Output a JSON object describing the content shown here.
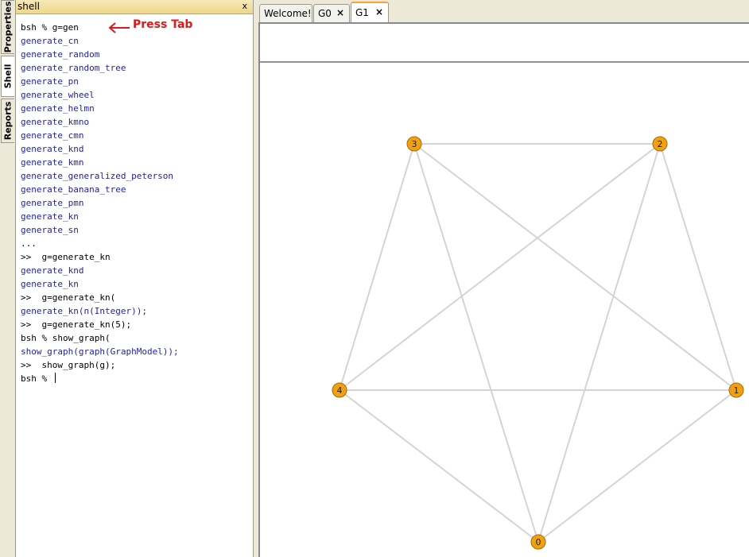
{
  "side_tabs": [
    "Properties",
    "Shell",
    "Reports"
  ],
  "shell": {
    "title": "shell",
    "close_label": "x",
    "lines": [
      {
        "text": "bsh % g=gen",
        "kind": "cmd"
      },
      {
        "text": "generate_cn",
        "kind": "out"
      },
      {
        "text": "generate_random",
        "kind": "out"
      },
      {
        "text": "generate_random_tree",
        "kind": "out"
      },
      {
        "text": "generate_pn",
        "kind": "out"
      },
      {
        "text": "generate_wheel",
        "kind": "out"
      },
      {
        "text": "generate_helmn",
        "kind": "out"
      },
      {
        "text": "generate_kmno",
        "kind": "out"
      },
      {
        "text": "generate_cmn",
        "kind": "out"
      },
      {
        "text": "generate_knd",
        "kind": "out"
      },
      {
        "text": "generate_kmn",
        "kind": "out"
      },
      {
        "text": "generate_generalized_peterson",
        "kind": "out"
      },
      {
        "text": "generate_banana_tree",
        "kind": "out"
      },
      {
        "text": "generate_pmn",
        "kind": "out"
      },
      {
        "text": "generate_kn",
        "kind": "out"
      },
      {
        "text": "generate_sn",
        "kind": "out"
      },
      {
        "text": "...",
        "kind": "cmd"
      },
      {
        "text": ">>  g=generate_kn",
        "kind": "cmd"
      },
      {
        "text": "generate_knd",
        "kind": "out"
      },
      {
        "text": "generate_kn",
        "kind": "out"
      },
      {
        "text": ">>  g=generate_kn(",
        "kind": "cmd"
      },
      {
        "text": "generate_kn(n(Integer));",
        "kind": "out"
      },
      {
        "text": ">>  g=generate_kn(5);",
        "kind": "cmd"
      },
      {
        "text": "bsh % show_graph(",
        "kind": "cmd"
      },
      {
        "text": "show_graph(graph(GraphModel));",
        "kind": "out"
      },
      {
        "text": ">>  show_graph(g);",
        "kind": "cmd"
      },
      {
        "text": "bsh % ",
        "kind": "cmd"
      }
    ]
  },
  "annotation": {
    "label": "Press Tab",
    "color": "#e01818"
  },
  "tabs": [
    {
      "label": "Welcome!",
      "closable": false,
      "active": false
    },
    {
      "label": "G0",
      "close_label": "×",
      "closable": true,
      "active": false
    },
    {
      "label": "G1",
      "close_label": "×",
      "closable": true,
      "active": true
    }
  ],
  "graph": {
    "node_color": "#f0a010",
    "edge_color": "#d4d4d4",
    "nodes": [
      {
        "id": "0",
        "label": "0"
      },
      {
        "id": "1",
        "label": "1"
      },
      {
        "id": "2",
        "label": "2"
      },
      {
        "id": "3",
        "label": "3"
      },
      {
        "id": "4",
        "label": "4"
      }
    ],
    "edges": [
      [
        "0",
        "1"
      ],
      [
        "0",
        "2"
      ],
      [
        "0",
        "3"
      ],
      [
        "0",
        "4"
      ],
      [
        "1",
        "2"
      ],
      [
        "1",
        "3"
      ],
      [
        "1",
        "4"
      ],
      [
        "2",
        "3"
      ],
      [
        "2",
        "4"
      ],
      [
        "3",
        "4"
      ]
    ]
  }
}
